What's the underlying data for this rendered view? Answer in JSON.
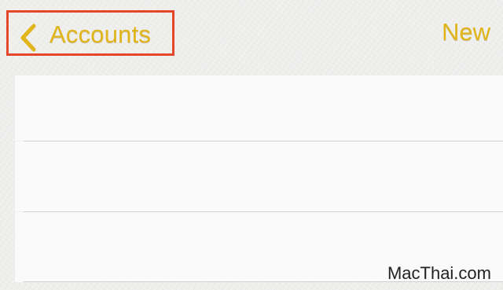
{
  "nav": {
    "back_label": "Accounts",
    "new_label": "New",
    "accent_color": "#e1b61c",
    "highlight_color": "#e4472c"
  },
  "icons": {
    "back": "chevron-left-icon"
  },
  "notes": [
    {
      "title": ""
    },
    {
      "title": ""
    },
    {
      "title": ""
    }
  ],
  "watermark": "MacThai.com"
}
